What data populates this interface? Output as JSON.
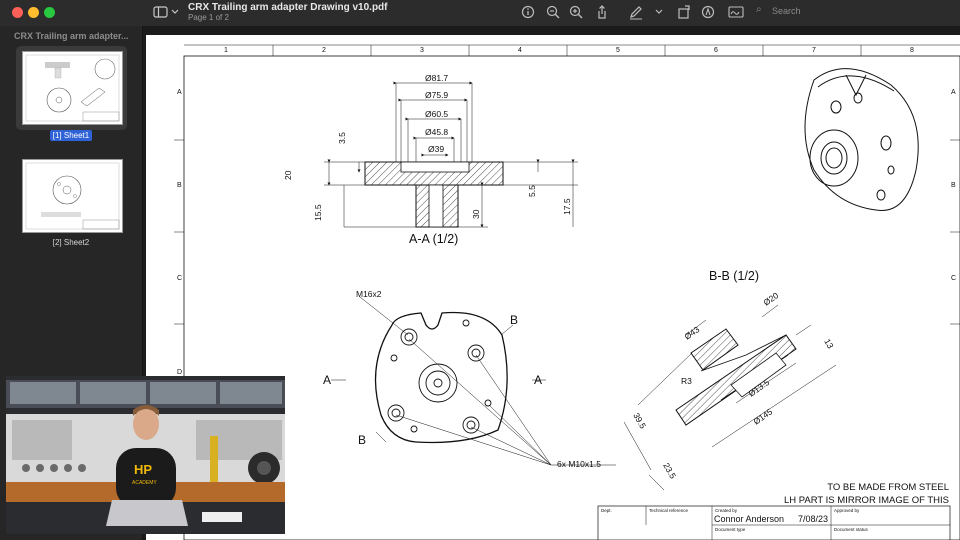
{
  "window": {
    "title": "CRX Trailing arm adapter Drawing v10.pdf",
    "subtitle": "Page 1 of 2",
    "search_placeholder": "Search"
  },
  "sidebar": {
    "header": "CRX Trailing arm adapter...",
    "pages": [
      {
        "label": "[1] Sheet1",
        "selected": true
      },
      {
        "label": "[2] Sheet2",
        "selected": false
      }
    ]
  },
  "drawing": {
    "border_cols": [
      "1",
      "2",
      "3",
      "4",
      "5",
      "6",
      "7",
      "8"
    ],
    "border_rows": [
      "A",
      "B",
      "C",
      "D"
    ],
    "section_aa": {
      "label": "A-A (1/2)",
      "dims": [
        "Ø81.7",
        "Ø75.9",
        "Ø60.5",
        "Ø45.8",
        "Ø39",
        "3.5",
        "20",
        "15.5",
        "30",
        "5.5",
        "17.5"
      ]
    },
    "section_bb": {
      "label": "B-B (1/2)",
      "dims": [
        "Ø43",
        "Ø20",
        "13",
        "R3",
        "Ø13.5",
        "Ø145",
        "39.5",
        "23.5"
      ]
    },
    "front_view": {
      "thread_label": "M16x2",
      "holes_label": "6x M10x1.5",
      "cut_a": "A",
      "cut_b": "B"
    },
    "notes": [
      "TO BE MADE FROM STEEL",
      "LH PART IS MIRROR IMAGE OF THIS"
    ],
    "title_block": {
      "dept": "Dept.",
      "technical_reference": "Technical reference",
      "created_by_label": "Created by",
      "created_by": "Connor Anderson",
      "date": "7/08/23",
      "approved_by_label": "Approved by",
      "document_type_label": "Document type",
      "document_status_label": "Document status"
    }
  },
  "video_overlay": {
    "shirt_text_1": "HP",
    "shirt_text_2": "ACADEMY"
  },
  "colors": {
    "titlebar": "#2c2c2c",
    "sidebar": "#262626",
    "selection": "#2f62d6",
    "hatch": "#222222"
  }
}
